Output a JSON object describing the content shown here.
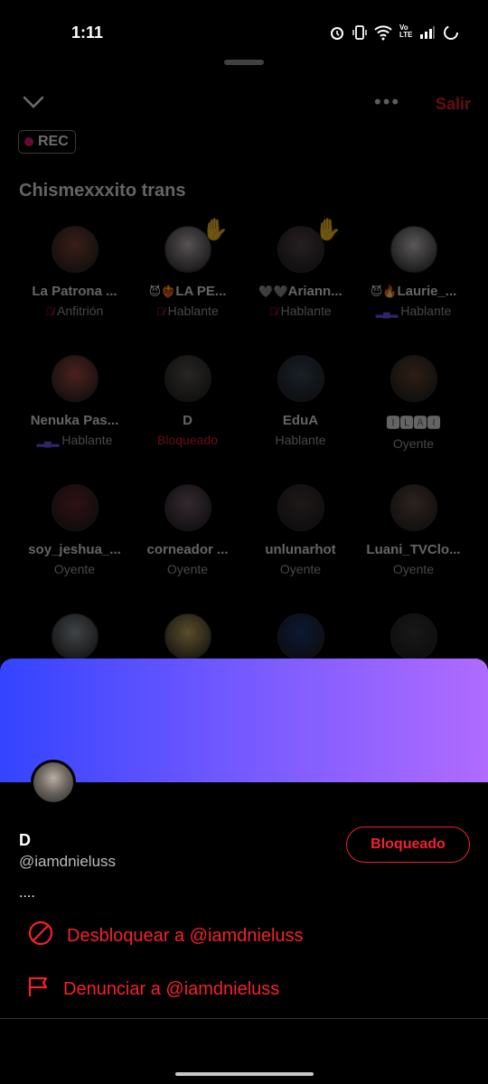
{
  "status_bar": {
    "time": "1:11",
    "icons": [
      "alarm-icon",
      "vibrate-icon",
      "wifi-icon",
      "volte-icon",
      "signal-icon",
      "battery-icon"
    ],
    "volte_label": "Vo LTE"
  },
  "space": {
    "exit_label": "Salir",
    "more_label": "•••",
    "rec_label": "REC",
    "title": "Chismexxxito trans",
    "participants": [
      {
        "name": "La Patrona ...",
        "role": "Anfitrión",
        "prefix": "",
        "role_icon": "mic-off",
        "hand": false,
        "avatar_color": "#8a4a3a"
      },
      {
        "name": "LA PE...",
        "role": "Hablante",
        "prefix": "😈❤️‍🔥",
        "role_icon": "mic-off",
        "hand": true,
        "avatar_color": "#cfc2c9"
      },
      {
        "name": "Ariann...",
        "role": "Hablante",
        "prefix": "🩶🩶",
        "role_icon": "mic-off",
        "hand": true,
        "avatar_color": "#5a4a50"
      },
      {
        "name": "Laurie_...",
        "role": "Hablante",
        "prefix": "😈🔥",
        "role_icon": "bars",
        "hand": false,
        "avatar_color": "#d8d2d6"
      },
      {
        "name": "Nenuka Pas...",
        "role": "Hablante",
        "prefix": "",
        "role_icon": "bars",
        "hand": false,
        "avatar_color": "#b2524a"
      },
      {
        "name": "D",
        "role": "Bloqueado",
        "prefix": "",
        "role_icon": "",
        "hand": false,
        "avatar_color": "#5e5a55"
      },
      {
        "name": "EduA",
        "role": "Hablante",
        "prefix": "",
        "role_icon": "",
        "hand": false,
        "avatar_color": "#3b4b5e"
      },
      {
        "name": "🅸🅻🅰🅸",
        "role": "Oyente",
        "prefix": "",
        "role_icon": "",
        "hand": false,
        "avatar_color": "#6a4a36"
      },
      {
        "name": "soy_jeshua_...",
        "role": "Oyente",
        "prefix": "",
        "role_icon": "",
        "hand": false,
        "avatar_color": "#6e2a2e"
      },
      {
        "name": "corneador ...",
        "role": "Oyente",
        "prefix": "",
        "role_icon": "",
        "hand": false,
        "avatar_color": "#7a6070"
      },
      {
        "name": "unlunarhot",
        "role": "Oyente",
        "prefix": "",
        "role_icon": "",
        "hand": false,
        "avatar_color": "#4a3a3c"
      },
      {
        "name": "Luani_TVClo...",
        "role": "Oyente",
        "prefix": "",
        "role_icon": "",
        "hand": false,
        "avatar_color": "#6b5448"
      },
      {
        "name": "",
        "role": "",
        "prefix": "",
        "role_icon": "",
        "hand": false,
        "avatar_color": "#9aa3ab"
      },
      {
        "name": "",
        "role": "",
        "prefix": "",
        "role_icon": "",
        "hand": false,
        "avatar_color": "#d7b86a"
      },
      {
        "name": "",
        "role": "",
        "prefix": "",
        "role_icon": "",
        "hand": false,
        "avatar_color": "#1f3b7a"
      },
      {
        "name": "",
        "role": "",
        "prefix": "",
        "role_icon": "",
        "hand": false,
        "avatar_color": "#3a3a3a"
      }
    ]
  },
  "profile_sheet": {
    "name": "D",
    "handle": "@iamdnieluss",
    "bio": "....",
    "blocked_button": "Bloqueado",
    "unblock_action": "Desbloquear a @iamdnieluss",
    "report_action": "Denunciar a @iamdnieluss",
    "banner_colors": [
      "#3344ff",
      "#b06bff"
    ],
    "accent_color": "#f4212e"
  }
}
